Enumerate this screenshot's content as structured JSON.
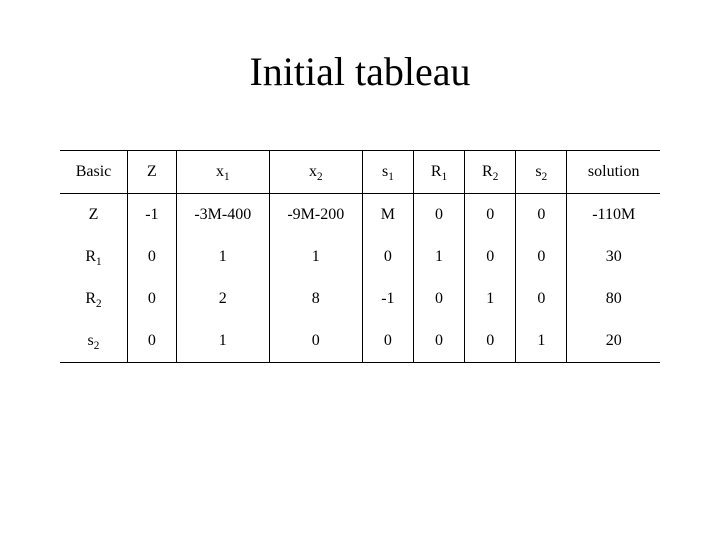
{
  "title": "Initial tableau",
  "headers": {
    "basic": "Basic",
    "z": "Z",
    "x1_base": "x",
    "x1_sub": "1",
    "x2_base": "x",
    "x2_sub": "2",
    "s1_base": "s",
    "s1_sub": "1",
    "r1_base": "R",
    "r1_sub": "1",
    "r2_base": "R",
    "r2_sub": "2",
    "s2_base": "s",
    "s2_sub": "2",
    "solution": "solution"
  },
  "rows": [
    {
      "basic_base": "Z",
      "basic_sub": "",
      "z": "-1",
      "x1": "-3M-400",
      "x2": "-9M-200",
      "s1": "M",
      "r1": "0",
      "r2": "0",
      "s2": "0",
      "solution": "-110M"
    },
    {
      "basic_base": "R",
      "basic_sub": "1",
      "z": "0",
      "x1": "1",
      "x2": "1",
      "s1": "0",
      "r1": "1",
      "r2": "0",
      "s2": "0",
      "solution": "30"
    },
    {
      "basic_base": "R",
      "basic_sub": "2",
      "z": "0",
      "x1": "2",
      "x2": "8",
      "s1": "-1",
      "r1": "0",
      "r2": "1",
      "s2": "0",
      "solution": "80"
    },
    {
      "basic_base": "s",
      "basic_sub": "2",
      "z": "0",
      "x1": "1",
      "x2": "0",
      "s1": "0",
      "r1": "0",
      "r2": "0",
      "s2": "1",
      "solution": "20"
    }
  ],
  "chart_data": {
    "type": "table",
    "title": "Initial tableau",
    "columns": [
      "Basic",
      "Z",
      "x1",
      "x2",
      "s1",
      "R1",
      "R2",
      "s2",
      "solution"
    ],
    "rows": [
      [
        "Z",
        "-1",
        "-3M-400",
        "-9M-200",
        "M",
        "0",
        "0",
        "0",
        "-110M"
      ],
      [
        "R1",
        "0",
        "1",
        "1",
        "0",
        "1",
        "0",
        "0",
        "30"
      ],
      [
        "R2",
        "0",
        "2",
        "8",
        "-1",
        "0",
        "1",
        "0",
        "80"
      ],
      [
        "s2",
        "0",
        "1",
        "0",
        "0",
        "0",
        "0",
        "1",
        "20"
      ]
    ]
  }
}
